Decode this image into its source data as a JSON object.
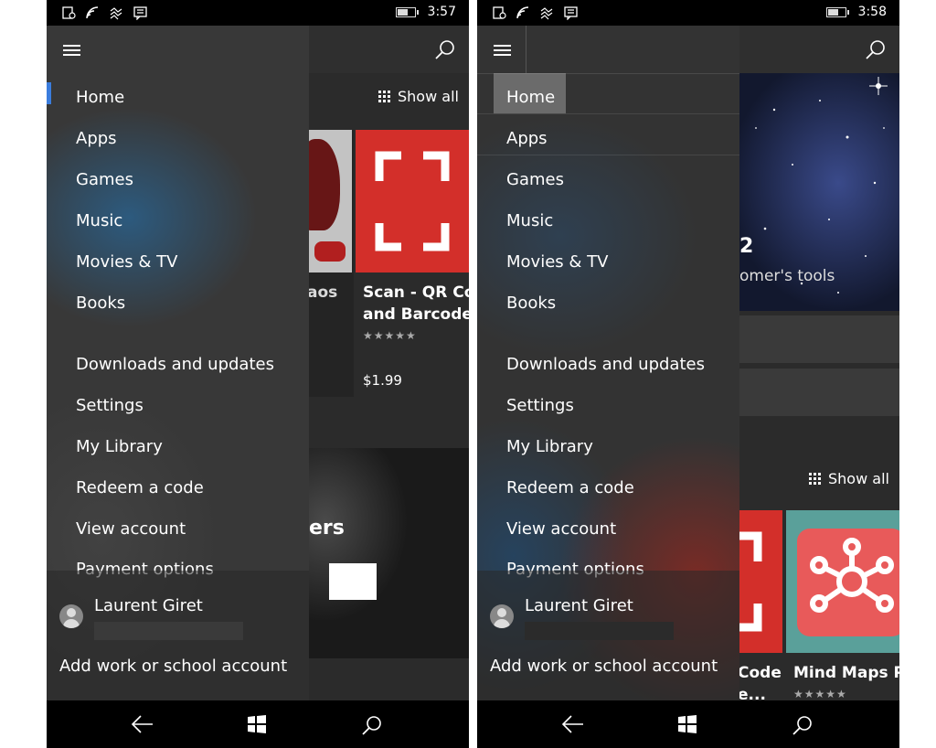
{
  "screens": [
    {
      "status": {
        "time": "3:57"
      },
      "drawer": {
        "items": [
          "Home",
          "Apps",
          "Games",
          "Music",
          "Movies & TV",
          "Books",
          "Downloads and updates",
          "Settings",
          "My Library",
          "Redeem a code",
          "View account",
          "Payment options"
        ],
        "account_name": "Laurent Giret",
        "add_account": "Add work or school account"
      },
      "content": {
        "show_all": "Show all",
        "app1_title_fragment": "aos",
        "app2_title": "Scan - QR Code",
        "app2_subtitle": "and Barcode...",
        "app2_stars": "★★★★★",
        "app2_price": "$1.99",
        "banner_fragment": "ers"
      },
      "colors": {
        "accent": "#3b7ddd",
        "scan_red": "#d32f2a"
      }
    },
    {
      "status": {
        "time": "3:58"
      },
      "drawer": {
        "items": [
          "Home",
          "Apps",
          "Games",
          "Music",
          "Movies & TV",
          "Books",
          "Downloads and updates",
          "Settings",
          "My Library",
          "Redeem a code",
          "View account",
          "Payment options"
        ],
        "account_name": "Laurent Giret",
        "add_account": "Add work or school account"
      },
      "content": {
        "hero_number": "2",
        "hero_caption": "omer's tools",
        "show_all": "Show all",
        "app1_title_fragment": "Code",
        "app1_subtitle_fragment": "e...",
        "app2_title": "Mind Maps P",
        "app2_stars": "★★★★★"
      },
      "colors": {
        "mindmap_bg": "#5aa09a",
        "mindmap_card": "#e85a5a"
      }
    }
  ]
}
